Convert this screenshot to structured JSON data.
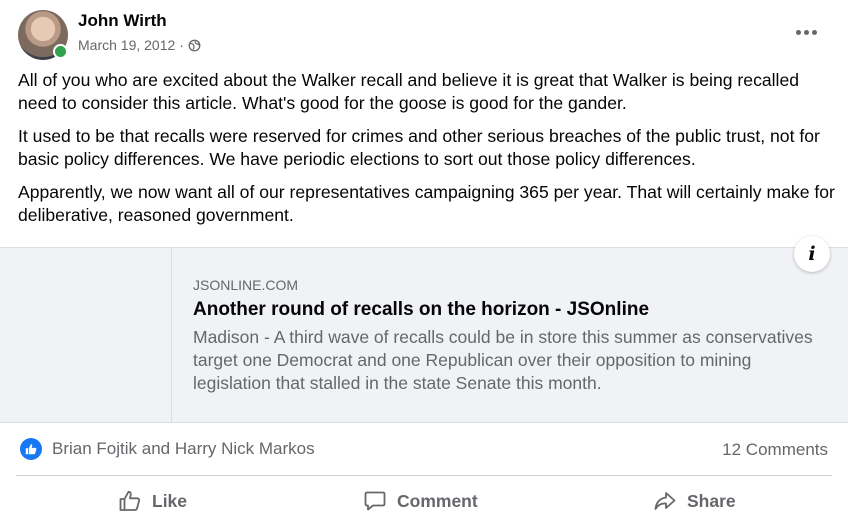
{
  "post": {
    "author": "John Wirth",
    "date": "March 19, 2012",
    "separator": "·",
    "privacy_icon": "globe-icon",
    "more_icon": "more-options-icon",
    "paragraphs": [
      "All of you who are excited about the Walker recall and believe it is great that Walker is being recalled need to consider this article.  What's good for the goose is good for the gander.",
      "It used to be that recalls were reserved for crimes and other serious breaches of the public trust, not for basic policy differences.  We have periodic elections to sort out those policy differences.",
      "Apparently, we now want all of our representatives campaigning 365 per year.  That will certainly make for deliberative, reasoned government."
    ]
  },
  "link_preview": {
    "domain": "JSONLINE.COM",
    "title": "Another round of recalls on the horizon - JSOnline",
    "description": "Madison - A third wave of recalls could be in store this summer as conservatives target one Democrat and one Republican over their opposition to mining legislation that stalled in the state Senate this month.",
    "info_label": "i"
  },
  "engagement": {
    "reactors": "Brian Fojtik and Harry Nick Markos",
    "comments": "12 Comments"
  },
  "actions": {
    "like": "Like",
    "comment": "Comment",
    "share": "Share"
  },
  "colors": {
    "accent": "#1877f2",
    "online": "#31a24c",
    "muted_text": "#65676b",
    "card_bg": "#f0f2f5"
  }
}
